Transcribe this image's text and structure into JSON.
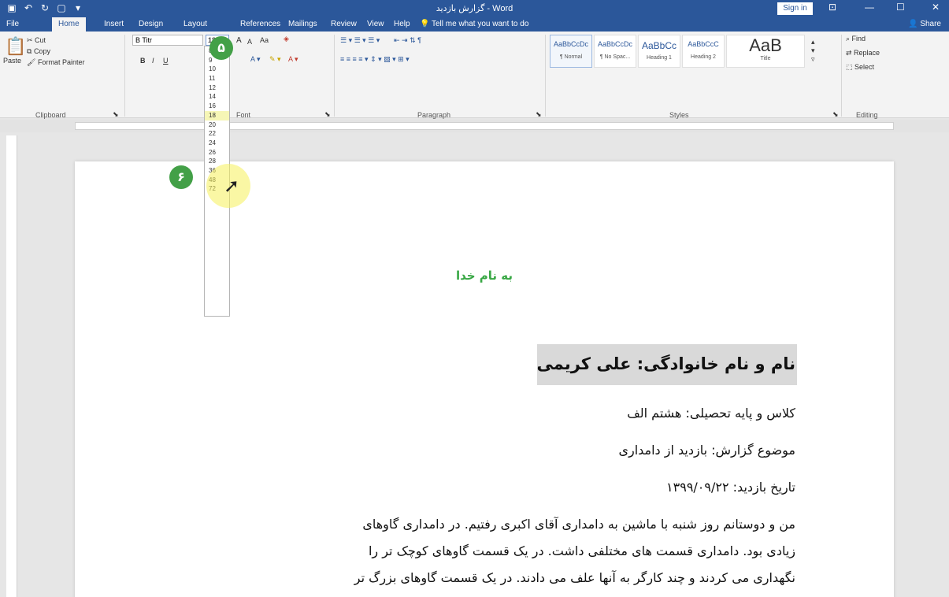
{
  "titlebar": {
    "title": "گزارش بازدید - Word",
    "signin": "Sign in",
    "qat": [
      "▣",
      "↶",
      "↻",
      "▢",
      "▾"
    ],
    "controls": [
      "⊡",
      "—",
      "☐",
      "✕"
    ]
  },
  "tabs": {
    "items": [
      "File",
      "Home",
      "Insert",
      "Design",
      "Layout",
      "References",
      "Mailings",
      "Review",
      "View",
      "Help"
    ],
    "tell_me": "Tell me what you want to do",
    "share": "Share"
  },
  "ribbon": {
    "clipboard": {
      "paste": "Paste",
      "cut": "Cut",
      "copy": "Copy",
      "format_painter": "Format Painter",
      "label": "Clipboard"
    },
    "font": {
      "name": "B Titr",
      "size": "18",
      "buttons": [
        "A",
        "A",
        "Aa",
        "B",
        "I",
        "U"
      ],
      "label": "Font"
    },
    "paragraph": {
      "label": "Paragraph"
    },
    "styles": {
      "items": [
        {
          "sample": "AaBbCcDc",
          "name": "¶ Normal"
        },
        {
          "sample": "AaBbCcDc",
          "name": "¶ No Spac..."
        },
        {
          "sample": "AaBbCc",
          "name": "Heading 1"
        },
        {
          "sample": "AaBbCcC",
          "name": "Heading 2"
        },
        {
          "sample": "AaB",
          "name": "Title"
        }
      ],
      "label": "Styles"
    },
    "editing": {
      "find": "Find",
      "replace": "Replace",
      "select": "Select",
      "label": "Editing"
    }
  },
  "font_size_dropdown": {
    "options": [
      "8",
      "9",
      "10",
      "11",
      "12",
      "14",
      "16",
      "18",
      "20",
      "22",
      "24",
      "26",
      "28",
      "36",
      "48",
      "72"
    ],
    "highlighted": "18"
  },
  "badges": {
    "step5": "۵",
    "step6": "۶"
  },
  "document": {
    "heading": "به نام خدا",
    "name_line": "نام و نام خانوادگی: علی کریمی",
    "class_line": "کلاس و پایه تحصیلی: هشتم الف",
    "subject_line": "موضوع گزارش: بازدید از دامداری",
    "date_line": "تاریخ بازدید: ۱۳۹۹/۰۹/۲۲",
    "para_line1": "من و دوستانم روز شنبه با ماشین به دامداری آقای اکبری رفتیم. در دامداری گاوهای",
    "para_line2": "زیادی بود. دامداری قسمت های مختلفی داشت. در یک قسمت گاوهای کوچک تر را",
    "para_line3": "نگهداری می کردند و چند کارگر به آنها علف می دادند. در یک قسمت گاوهای بزرگ تر"
  }
}
